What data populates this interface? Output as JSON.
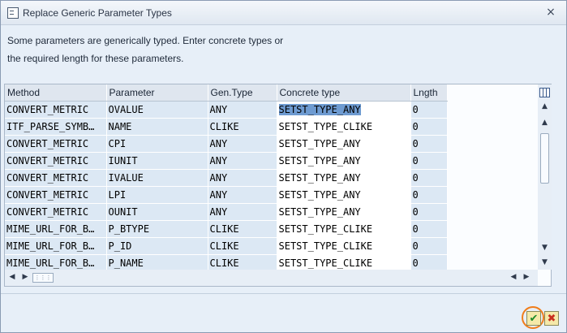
{
  "window": {
    "title": "Replace Generic Parameter Types",
    "close_symbol": "×"
  },
  "instruction": {
    "line1": "Some parameters are generically typed. Enter concrete types or",
    "line2": "the required length for these parameters."
  },
  "grid": {
    "columns": [
      "Method",
      "Parameter",
      "Gen.Type",
      "Concrete type",
      "Lngth"
    ],
    "rows": [
      {
        "method": "CONVERT_METRIC",
        "parameter": "OVALUE",
        "gen_type": "ANY",
        "concrete_type": "SETST_TYPE_ANY",
        "length": "0",
        "selected": true
      },
      {
        "method": "ITF_PARSE_SYMB…",
        "parameter": "NAME",
        "gen_type": "CLIKE",
        "concrete_type": "SETST_TYPE_CLIKE",
        "length": "0"
      },
      {
        "method": "CONVERT_METRIC",
        "parameter": "CPI",
        "gen_type": "ANY",
        "concrete_type": "SETST_TYPE_ANY",
        "length": "0"
      },
      {
        "method": "CONVERT_METRIC",
        "parameter": "IUNIT",
        "gen_type": "ANY",
        "concrete_type": "SETST_TYPE_ANY",
        "length": "0"
      },
      {
        "method": "CONVERT_METRIC",
        "parameter": "IVALUE",
        "gen_type": "ANY",
        "concrete_type": "SETST_TYPE_ANY",
        "length": "0"
      },
      {
        "method": "CONVERT_METRIC",
        "parameter": "LPI",
        "gen_type": "ANY",
        "concrete_type": "SETST_TYPE_ANY",
        "length": "0"
      },
      {
        "method": "CONVERT_METRIC",
        "parameter": "OUNIT",
        "gen_type": "ANY",
        "concrete_type": "SETST_TYPE_ANY",
        "length": "0"
      },
      {
        "method": "MIME_URL_FOR_B…",
        "parameter": "P_BTYPE",
        "gen_type": "CLIKE",
        "concrete_type": "SETST_TYPE_CLIKE",
        "length": "0"
      },
      {
        "method": "MIME_URL_FOR_B…",
        "parameter": "P_ID",
        "gen_type": "CLIKE",
        "concrete_type": "SETST_TYPE_CLIKE",
        "length": "0"
      },
      {
        "method": "MIME_URL_FOR_B…",
        "parameter": "P_NAME",
        "gen_type": "CLIKE",
        "concrete_type": "SETST_TYPE_CLIKE",
        "length": "0"
      }
    ]
  },
  "footer": {
    "ok_symbol": "✔",
    "cancel_symbol": "✖"
  },
  "colors": {
    "accent_selection": "#6e9bd1",
    "ok_highlight_ring": "#f07d1a"
  }
}
